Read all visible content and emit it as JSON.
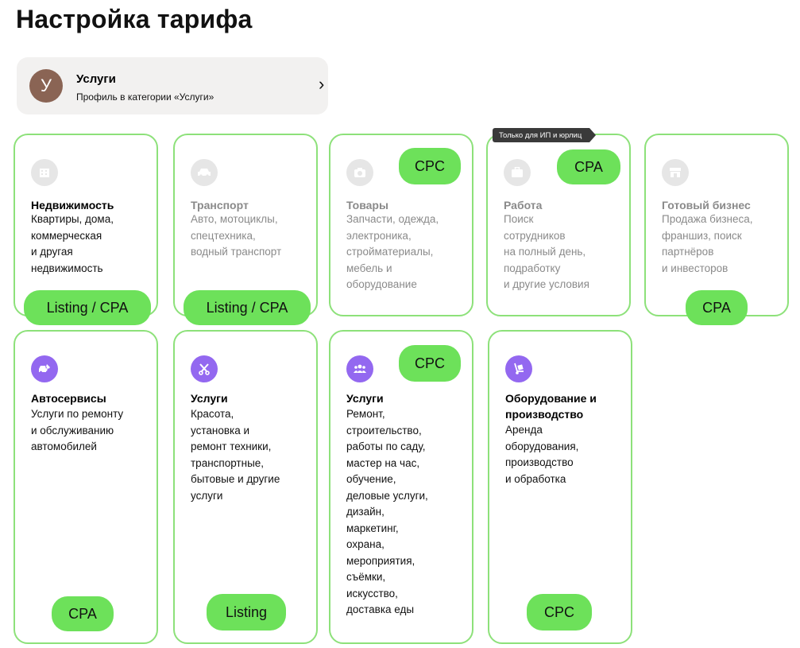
{
  "page": {
    "title": "Настройка тарифа"
  },
  "profile": {
    "avatar_letter": "У",
    "name": "Услуги",
    "subtitle": "Профиль в категории «Услуги»",
    "chevron": "›"
  },
  "badge": "Только для ИП и юрлиц",
  "colors": {
    "accent": "#6de15a",
    "border": "#8de17a",
    "purple": "#9368f0",
    "avatar": "#8a6454"
  },
  "cards": [
    {
      "title": "Недвижимость",
      "desc": [
        "Квартиры, дома,",
        "коммерческая",
        "и другая",
        "недвижимость"
      ],
      "pill": "Listing / CPA",
      "icon": "building-icon",
      "dimmed": false
    },
    {
      "title": "Транспорт",
      "desc": [
        "Авто, мотоциклы,",
        "спецтехника,",
        "водный транспорт"
      ],
      "pill": "Listing / CPA",
      "icon": "car-icon",
      "dimmed": true
    },
    {
      "title": "Товары",
      "desc": [
        "Запчасти, одежда,",
        "электроника,",
        "стройматериалы,",
        "мебель и",
        "оборудование"
      ],
      "pill": "CPC",
      "icon": "camera-icon",
      "dimmed": true
    },
    {
      "title": "Работа",
      "desc": [
        "Поиск",
        "сотрудников",
        "на полный день,",
        "подработку",
        "и другие условия"
      ],
      "pill": "CPA",
      "icon": "briefcase-icon",
      "dimmed": true
    },
    {
      "title": "Готовый бизнес",
      "desc": [
        "Продажа бизнеса,",
        "франшиз, поиск",
        "партнёров",
        "и инвесторов"
      ],
      "pill": "CPA",
      "icon": "shop-icon",
      "dimmed": true
    },
    {
      "title": "Автосервисы",
      "desc": [
        "Услуги по ремонту",
        "и обслуживанию",
        "автомобилей"
      ],
      "pill": "CPA",
      "icon": "car-repair-icon",
      "dimmed": false
    },
    {
      "title": "Услуги",
      "desc": [
        "Красота,",
        "установка и",
        "ремонт техники,",
        "транспортные,",
        "бытовые и другие",
        "услуги"
      ],
      "pill": "Listing",
      "icon": "scissors-icon",
      "dimmed": false
    },
    {
      "title": "Услуги",
      "desc": [
        "Ремонт,",
        "строительство,",
        "работы по саду,",
        "мастер на час,",
        "обучение,",
        "деловые услуги,",
        "дизайн,",
        "маркетинг,",
        "охрана,",
        "мероприятия,",
        "съёмки,",
        "искусство,",
        "доставка еды"
      ],
      "pill": "CPC",
      "icon": "people-icon",
      "dimmed": false
    },
    {
      "title": "Оборудование и производство",
      "desc": [
        "Аренда",
        "оборудования,",
        "производство",
        "и обработка"
      ],
      "pill": "CPC",
      "icon": "hand-truck-icon",
      "dimmed": false
    }
  ]
}
